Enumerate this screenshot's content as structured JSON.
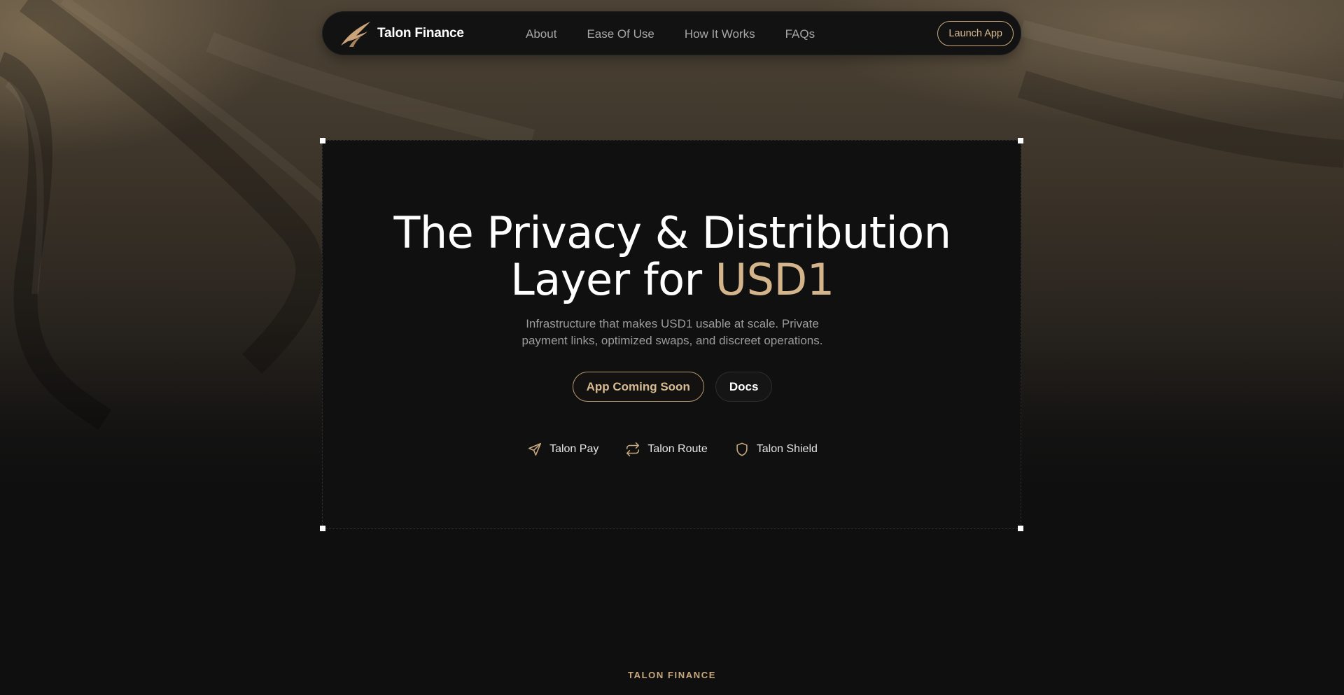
{
  "brand": {
    "name": "Talon Finance",
    "accent_color": "#d4b48b",
    "logo_icon": "talon-wing-logo-icon"
  },
  "nav": {
    "links": [
      {
        "label": "About"
      },
      {
        "label": "Ease Of Use"
      },
      {
        "label": "How It Works"
      },
      {
        "label": "FAQs"
      }
    ],
    "launch_label": "Launch App"
  },
  "hero": {
    "headline_line1": "The Privacy & Distribution",
    "headline_line2_prefix": "Layer for ",
    "headline_line2_accent": "USD1",
    "subtitle_line1": "Infrastructure that makes USD1 usable at scale. Private",
    "subtitle_line2": "payment links, optimized swaps, and discreet operations.",
    "primary_cta": "App Coming Soon",
    "secondary_cta": "Docs",
    "features": [
      {
        "label": "Talon Pay",
        "icon": "send-icon"
      },
      {
        "label": "Talon Route",
        "icon": "repeat-icon"
      },
      {
        "label": "Talon Shield",
        "icon": "shield-icon"
      }
    ]
  },
  "footer": {
    "label": "TALON FINANCE"
  }
}
